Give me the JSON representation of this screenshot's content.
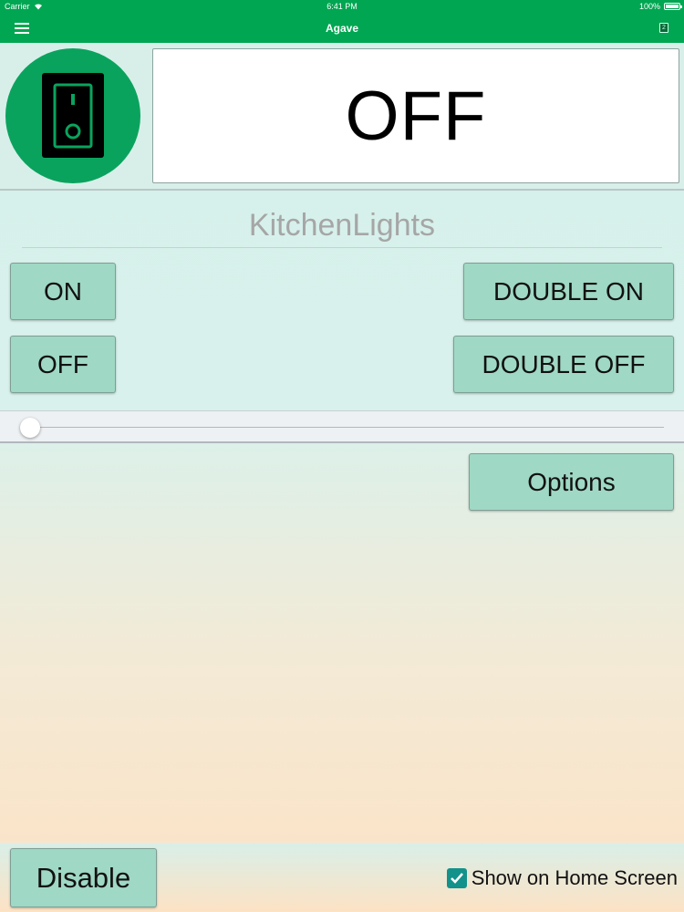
{
  "status_bar": {
    "carrier": "Carrier",
    "time": "6:41 PM",
    "battery": "100%"
  },
  "nav": {
    "title": "Agave",
    "right_icon_badge": "2"
  },
  "device": {
    "state": "OFF",
    "name": "KitchenLights",
    "dim_level": 0
  },
  "buttons": {
    "on": "ON",
    "double_on": "DOUBLE ON",
    "off": "OFF",
    "double_off": "DOUBLE OFF",
    "options": "Options",
    "disable": "Disable"
  },
  "home_screen": {
    "label": "Show on Home Screen",
    "checked": true
  },
  "colors": {
    "brand_green": "#00a651",
    "button_fill": "#9fd8c4",
    "checkbox": "#12928a"
  },
  "icons": {
    "menu": "hamburger-menu-icon",
    "switch": "light-switch-icon",
    "wifi": "wifi-icon",
    "battery": "battery-icon",
    "checkmark": "checkmark-icon"
  }
}
